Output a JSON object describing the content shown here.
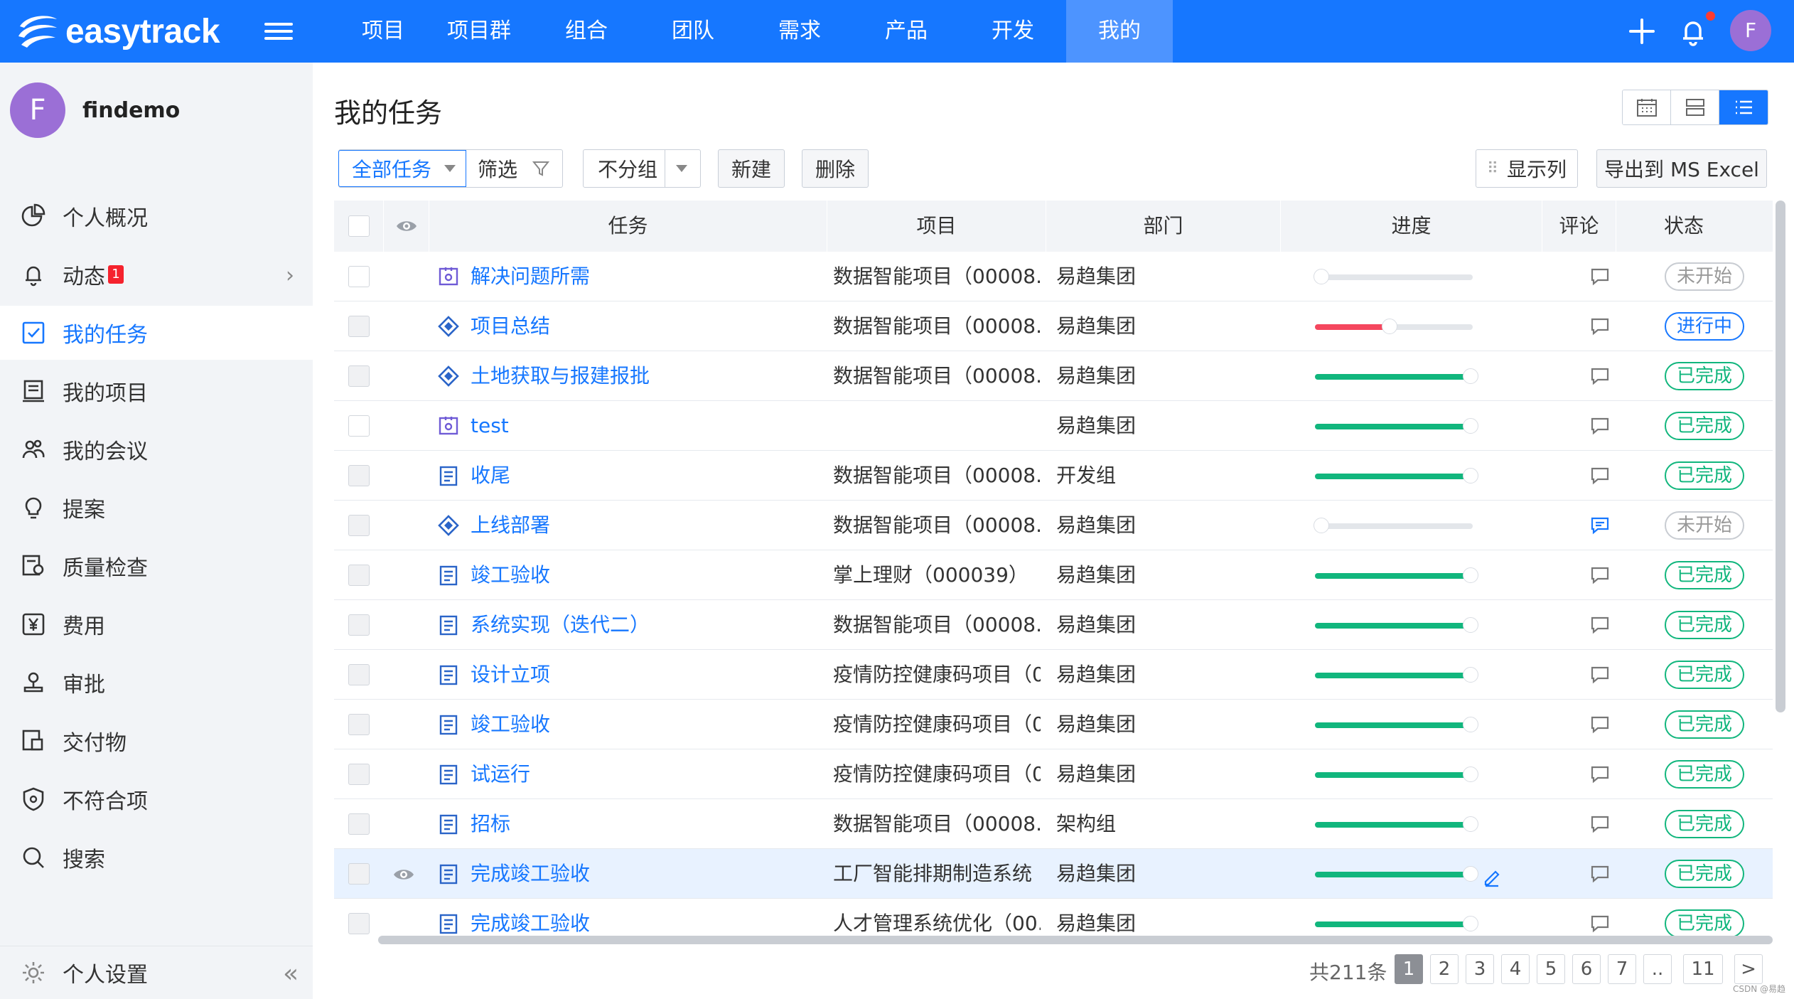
{
  "brand": {
    "name": "easytrack"
  },
  "nav": {
    "items": [
      "项目",
      "项目群",
      "组合",
      "团队",
      "需求",
      "产品",
      "开发",
      "我的"
    ],
    "active": "我的"
  },
  "user": {
    "initial": "F",
    "name": "findemo"
  },
  "sidebar": {
    "items": [
      {
        "label": "个人概况",
        "icon": "pie-chart-icon"
      },
      {
        "label": "动态",
        "icon": "bell-icon",
        "badge": "1"
      },
      {
        "label": "我的任务",
        "icon": "task-check-icon"
      },
      {
        "label": "我的项目",
        "icon": "project-icon"
      },
      {
        "label": "我的会议",
        "icon": "meeting-icon"
      },
      {
        "label": "提案",
        "icon": "lightbulb-icon"
      },
      {
        "label": "质量检查",
        "icon": "quality-icon"
      },
      {
        "label": "费用",
        "icon": "yen-icon"
      },
      {
        "label": "审批",
        "icon": "approval-icon"
      },
      {
        "label": "交付物",
        "icon": "deliverable-icon"
      },
      {
        "label": "不符合项",
        "icon": "shield-icon"
      },
      {
        "label": "搜索",
        "icon": "search-icon"
      }
    ],
    "settings_label": "个人设置"
  },
  "page": {
    "title": "我的任务"
  },
  "toolbar": {
    "all_tasks": "全部任务",
    "filter": "筛选",
    "group": "不分组",
    "new": "新建",
    "delete": "删除",
    "columns": "显示列",
    "export": "导出到 MS Excel"
  },
  "table": {
    "columns": [
      "任务",
      "项目",
      "部门",
      "进度",
      "评论",
      "状态"
    ],
    "rows": [
      {
        "icon": "milestone-icon",
        "task": "解决问题所需",
        "project": "数据智能项目（00008...",
        "dept": "易趋集团",
        "progress": 0,
        "status": "未开始",
        "state": "todo"
      },
      {
        "icon": "diamond-icon",
        "task": "项目总结",
        "project": "数据智能项目（00008...",
        "dept": "易趋集团",
        "progress": 0.45,
        "status": "进行中",
        "state": "doing"
      },
      {
        "icon": "diamond-icon",
        "task": "土地获取与报建报批",
        "project": "数据智能项目（00008...",
        "dept": "易趋集团",
        "progress": 1,
        "status": "已完成",
        "state": "done"
      },
      {
        "icon": "milestone-icon",
        "task": "test",
        "project": "",
        "dept": "易趋集团",
        "progress": 1,
        "status": "已完成",
        "state": "done"
      },
      {
        "icon": "task-icon",
        "task": "收尾",
        "project": "数据智能项目（00008...",
        "dept": "开发组",
        "progress": 1,
        "status": "已完成",
        "state": "done"
      },
      {
        "icon": "diamond-icon",
        "task": "上线部署",
        "project": "数据智能项目（00008...",
        "dept": "易趋集团",
        "progress": 0,
        "status": "未开始",
        "state": "todo",
        "comment_active": true
      },
      {
        "icon": "task-icon",
        "task": "竣工验收",
        "project": "掌上理财（000039）",
        "dept": "易趋集团",
        "progress": 1,
        "status": "已完成",
        "state": "done"
      },
      {
        "icon": "task-icon",
        "task": "系统实现（迭代二）",
        "project": "数据智能项目（00008...",
        "dept": "易趋集团",
        "progress": 1,
        "status": "已完成",
        "state": "done"
      },
      {
        "icon": "task-icon",
        "task": "设计立项",
        "project": "疫情防控健康码项目（0...",
        "dept": "易趋集团",
        "progress": 1,
        "status": "已完成",
        "state": "done"
      },
      {
        "icon": "task-icon",
        "task": "竣工验收",
        "project": "疫情防控健康码项目（0...",
        "dept": "易趋集团",
        "progress": 1,
        "status": "已完成",
        "state": "done"
      },
      {
        "icon": "task-icon",
        "task": "试运行",
        "project": "疫情防控健康码项目（0...",
        "dept": "易趋集团",
        "progress": 1,
        "status": "已完成",
        "state": "done"
      },
      {
        "icon": "task-icon",
        "task": "招标",
        "project": "数据智能项目（00008...",
        "dept": "架构组",
        "progress": 1,
        "status": "已完成",
        "state": "done"
      },
      {
        "icon": "task-icon",
        "task": "完成竣工验收",
        "project": "工厂智能排期制造系统（...",
        "dept": "易趋集团",
        "progress": 1,
        "status": "已完成",
        "state": "done",
        "highlighted": true
      },
      {
        "icon": "task-icon",
        "task": "完成竣工验收",
        "project": "人才管理系统优化（00...",
        "dept": "易趋集团",
        "progress": 1,
        "status": "已完成",
        "state": "done"
      }
    ]
  },
  "pagination": {
    "total": "共211条",
    "pages": [
      "1",
      "2",
      "3",
      "4",
      "5",
      "6",
      "7",
      "..",
      "11"
    ],
    "current": "1",
    "next": ">"
  },
  "watermark": "CSDN @易趋",
  "colors": {
    "primary": "#1677ff",
    "done": "#11b67d",
    "doing_bar": "#f5475e",
    "todo": "#999999"
  }
}
